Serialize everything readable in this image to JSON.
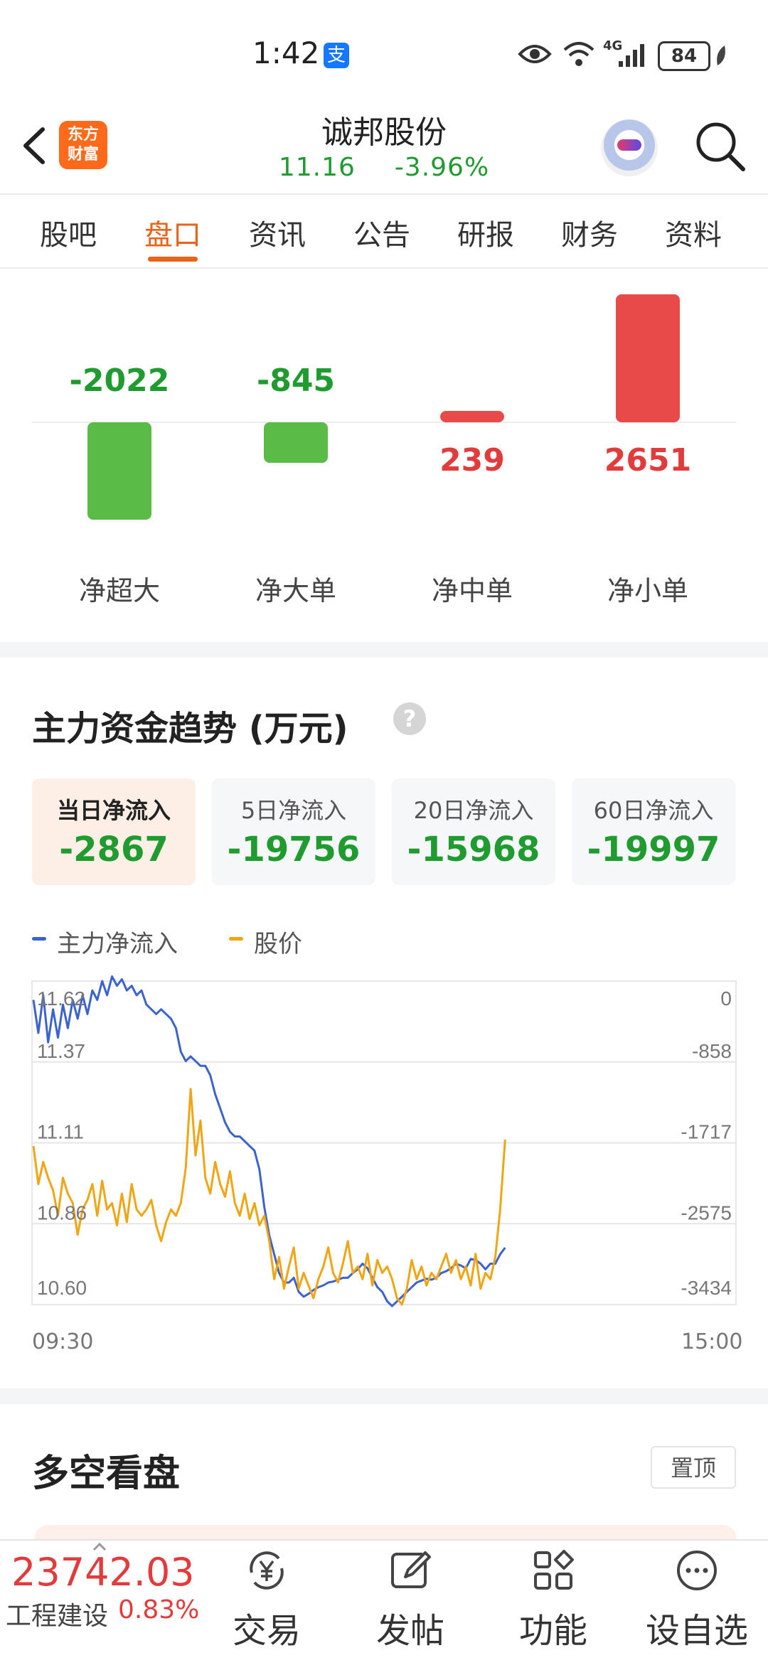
{
  "status_bar": {
    "time": "1:42",
    "alipay_badge": "支",
    "network": "4G",
    "battery": "84"
  },
  "header": {
    "logo_line1": "东方",
    "logo_line2": "财富",
    "stock_name": "诚邦股份",
    "price": "11.16",
    "change_pct": "-3.96%"
  },
  "tabs": [
    {
      "label": "股吧",
      "active": false
    },
    {
      "label": "盘口",
      "active": true
    },
    {
      "label": "资讯",
      "active": false
    },
    {
      "label": "公告",
      "active": false
    },
    {
      "label": "研报",
      "active": false
    },
    {
      "label": "财务",
      "active": false
    },
    {
      "label": "资料",
      "active": false
    }
  ],
  "net_flow": {
    "items": [
      {
        "label": "净超大",
        "value": -2022,
        "display": "-2022"
      },
      {
        "label": "净大单",
        "value": -845,
        "display": "-845"
      },
      {
        "label": "净中单",
        "value": 239,
        "display": "239"
      },
      {
        "label": "净小单",
        "value": 2651,
        "display": "2651"
      }
    ],
    "colors": {
      "positive": "#e84a4a",
      "negative": "#5bbb47"
    }
  },
  "main_trend": {
    "title": "主力资金趋势 (万元)",
    "help_icon": "question-icon",
    "periods": [
      {
        "label": "当日净流入",
        "value": "-2867",
        "active": true
      },
      {
        "label": "5日净流入",
        "value": "-19756",
        "active": false
      },
      {
        "label": "20日净流入",
        "value": "-15968",
        "active": false
      },
      {
        "label": "60日净流入",
        "value": "-19997",
        "active": false
      }
    ],
    "legend": [
      {
        "name": "主力净流入",
        "color": "#3b63cf"
      },
      {
        "name": "股价",
        "color": "#f0a514"
      }
    ]
  },
  "chart_data": {
    "type": "line",
    "x_start": "09:30",
    "x_end": "15:00",
    "left_axis_ticks": [
      "11.62",
      "11.37",
      "11.11",
      "10.86",
      "10.60"
    ],
    "right_axis_ticks": [
      "0",
      "-858",
      "-1717",
      "-2575",
      "-3434"
    ],
    "y_left_range": [
      10.6,
      11.62
    ],
    "y_right_range": [
      -3434,
      0
    ],
    "grid": true,
    "series": [
      {
        "name": "主力净流入",
        "axis": "right",
        "color": "#3b63cf",
        "values": [
          -200,
          -550,
          -150,
          -650,
          -300,
          -600,
          -250,
          -500,
          -200,
          -400,
          -150,
          -350,
          -100,
          -200,
          0,
          -150,
          50,
          -50,
          20,
          -100,
          -50,
          -150,
          -100,
          -250,
          -300,
          -350,
          -300,
          -350,
          -400,
          -500,
          -750,
          -850,
          -800,
          -850,
          -900,
          -900,
          -1000,
          -1200,
          -1350,
          -1500,
          -1600,
          -1650,
          -1650,
          -1700,
          -1750,
          -1800,
          -2000,
          -2400,
          -2700,
          -2900,
          -3100,
          -3200,
          -3200,
          -3150,
          -3300,
          -3350,
          -3320,
          -3280,
          -3250,
          -3230,
          -3200,
          -3190,
          -3170,
          -3150,
          -3150,
          -3100,
          -3060,
          -3000,
          -3050,
          -3150,
          -3250,
          -3300,
          -3400,
          -3450,
          -3400,
          -3350,
          -3300,
          -3250,
          -3200,
          -3180,
          -3160,
          -3170,
          -3150,
          -3100,
          -3080,
          -3050,
          -3000,
          -3020,
          -3050,
          -2950,
          -2960,
          -3000,
          -3060,
          -3000,
          -3000,
          -2900,
          -2830
        ]
      },
      {
        "name": "股价",
        "axis": "left",
        "color": "#f0a514",
        "values": [
          11.1,
          10.98,
          11.05,
          11.0,
          10.96,
          10.88,
          11.0,
          10.95,
          10.92,
          10.82,
          10.9,
          10.93,
          10.98,
          10.88,
          10.99,
          10.9,
          10.92,
          10.85,
          10.95,
          10.86,
          10.98,
          10.9,
          10.88,
          10.9,
          10.93,
          10.85,
          10.8,
          10.86,
          10.9,
          10.88,
          10.92,
          11.03,
          11.28,
          11.07,
          11.18,
          11.0,
          10.95,
          11.05,
          10.98,
          10.94,
          11.02,
          10.92,
          10.88,
          10.95,
          10.87,
          10.92,
          10.85,
          10.88,
          10.8,
          10.68,
          10.75,
          10.65,
          10.72,
          10.78,
          10.65,
          10.7,
          10.66,
          10.62,
          10.68,
          10.72,
          10.78,
          10.7,
          10.67,
          10.73,
          10.8,
          10.7,
          10.72,
          10.68,
          10.76,
          10.66,
          10.74,
          10.7,
          10.72,
          10.68,
          10.62,
          10.6,
          10.65,
          10.74,
          10.68,
          10.72,
          10.66,
          10.7,
          10.68,
          10.72,
          10.76,
          10.7,
          10.74,
          10.68,
          10.72,
          10.66,
          10.76,
          10.65,
          10.7,
          10.68,
          10.75,
          10.9,
          11.12
        ]
      }
    ]
  },
  "long_short": {
    "title": "多空看盘",
    "pin_label": "置顶"
  },
  "bottom_bar": {
    "index_value": "23742.03",
    "index_name": "工程建设",
    "index_pct": "0.83%",
    "nav": [
      {
        "label": "交易",
        "icon": "yen-refresh-icon"
      },
      {
        "label": "发帖",
        "icon": "edit-icon"
      },
      {
        "label": "功能",
        "icon": "grid-icon"
      },
      {
        "label": "设自选",
        "icon": "more-icon"
      }
    ]
  }
}
